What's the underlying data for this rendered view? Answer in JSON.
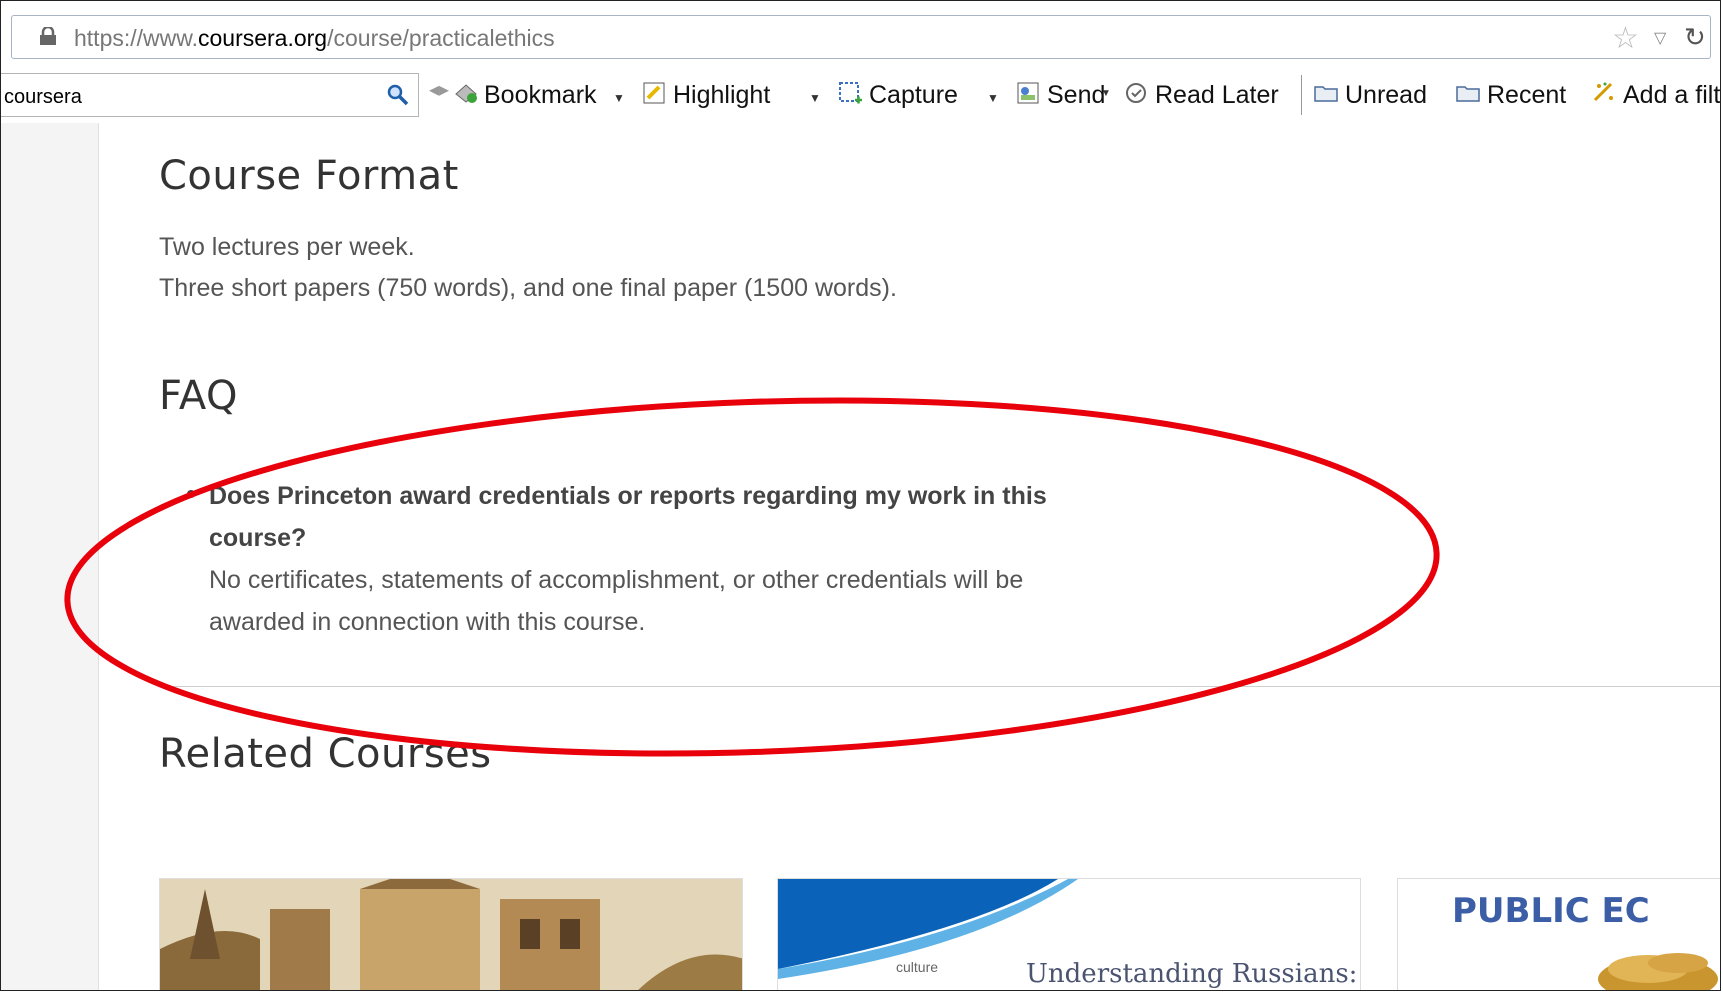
{
  "browser": {
    "url_prefix": "https://www.",
    "url_domain": "coursera.org",
    "url_path": "/course/practicalethics"
  },
  "toolbar": {
    "search_value": "coursera",
    "bookmark": "Bookmark",
    "highlight": "Highlight",
    "capture": "Capture",
    "send": "Send",
    "read_later": "Read Later",
    "unread": "Unread",
    "recent": "Recent",
    "add_filter": "Add a filt"
  },
  "course_format": {
    "heading": "Course Format",
    "line1": "Two lectures per week.",
    "line2": "Three short papers (750 words), and one final paper (1500 words)."
  },
  "faq": {
    "heading": "FAQ",
    "question_line1": "Does Princeton award credentials or reports regarding my work in this",
    "question_line2": "course?",
    "answer_line1": "No certificates, statements of accomplishment, or other credentials will be",
    "answer_line2": "awarded in connection with this course."
  },
  "related": {
    "heading": "Related Courses",
    "cards": [
      {
        "title": ""
      },
      {
        "title": "Understanding Russians:",
        "logo": "culture"
      },
      {
        "title": "PUBLIC EC"
      }
    ]
  },
  "colors": {
    "annotation": "#e8000b"
  }
}
